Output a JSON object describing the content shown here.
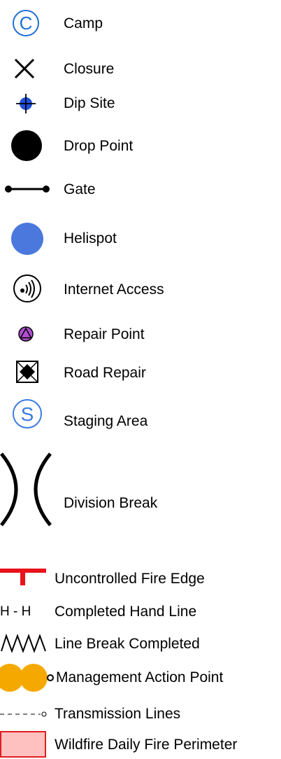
{
  "legend": {
    "items": [
      {
        "label": "Camp",
        "symbol": "camp-icon"
      },
      {
        "label": "Closure",
        "symbol": "closure-icon"
      },
      {
        "label": "Dip Site",
        "symbol": "dip-site-icon"
      },
      {
        "label": "Drop Point",
        "symbol": "drop-point-icon"
      },
      {
        "label": "Gate",
        "symbol": "gate-icon"
      },
      {
        "label": "Helispot",
        "symbol": "helispot-icon"
      },
      {
        "label": "Internet Access",
        "symbol": "internet-access-icon"
      },
      {
        "label": "Repair Point",
        "symbol": "repair-point-icon"
      },
      {
        "label": "Road Repair",
        "symbol": "road-repair-icon"
      },
      {
        "label": "Staging Area",
        "symbol": "staging-area-icon"
      },
      {
        "label": "Division Break",
        "symbol": "division-break-icon"
      },
      {
        "label": "Uncontrolled Fire Edge",
        "symbol": "uncontrolled-fire-edge-icon"
      },
      {
        "label": "Completed Hand Line",
        "symbol": "completed-hand-line-icon"
      },
      {
        "label": "Line Break Completed",
        "symbol": "line-break-completed-icon"
      },
      {
        "label": "Management Action Point",
        "symbol": "management-action-point-icon"
      },
      {
        "label": "Transmission Lines",
        "symbol": "transmission-lines-icon"
      },
      {
        "label": "Wildfire Daily Fire Perimeter",
        "symbol": "wildfire-daily-fire-perimeter-icon"
      }
    ],
    "glyphs": {
      "camp": "C",
      "staging": "S",
      "hand_line": "H - H"
    },
    "colors": {
      "camp": "#1f6fd6",
      "dip_site": "#1f4fe0",
      "helispot": "#4a78dd",
      "repair_point": "#b04fd0",
      "staging": "#3c7be0",
      "fire_edge": "#e8121b",
      "management_action": "#f5a900",
      "perimeter_fill": "#ffc0c0",
      "perimeter_stroke": "#e02020"
    }
  }
}
